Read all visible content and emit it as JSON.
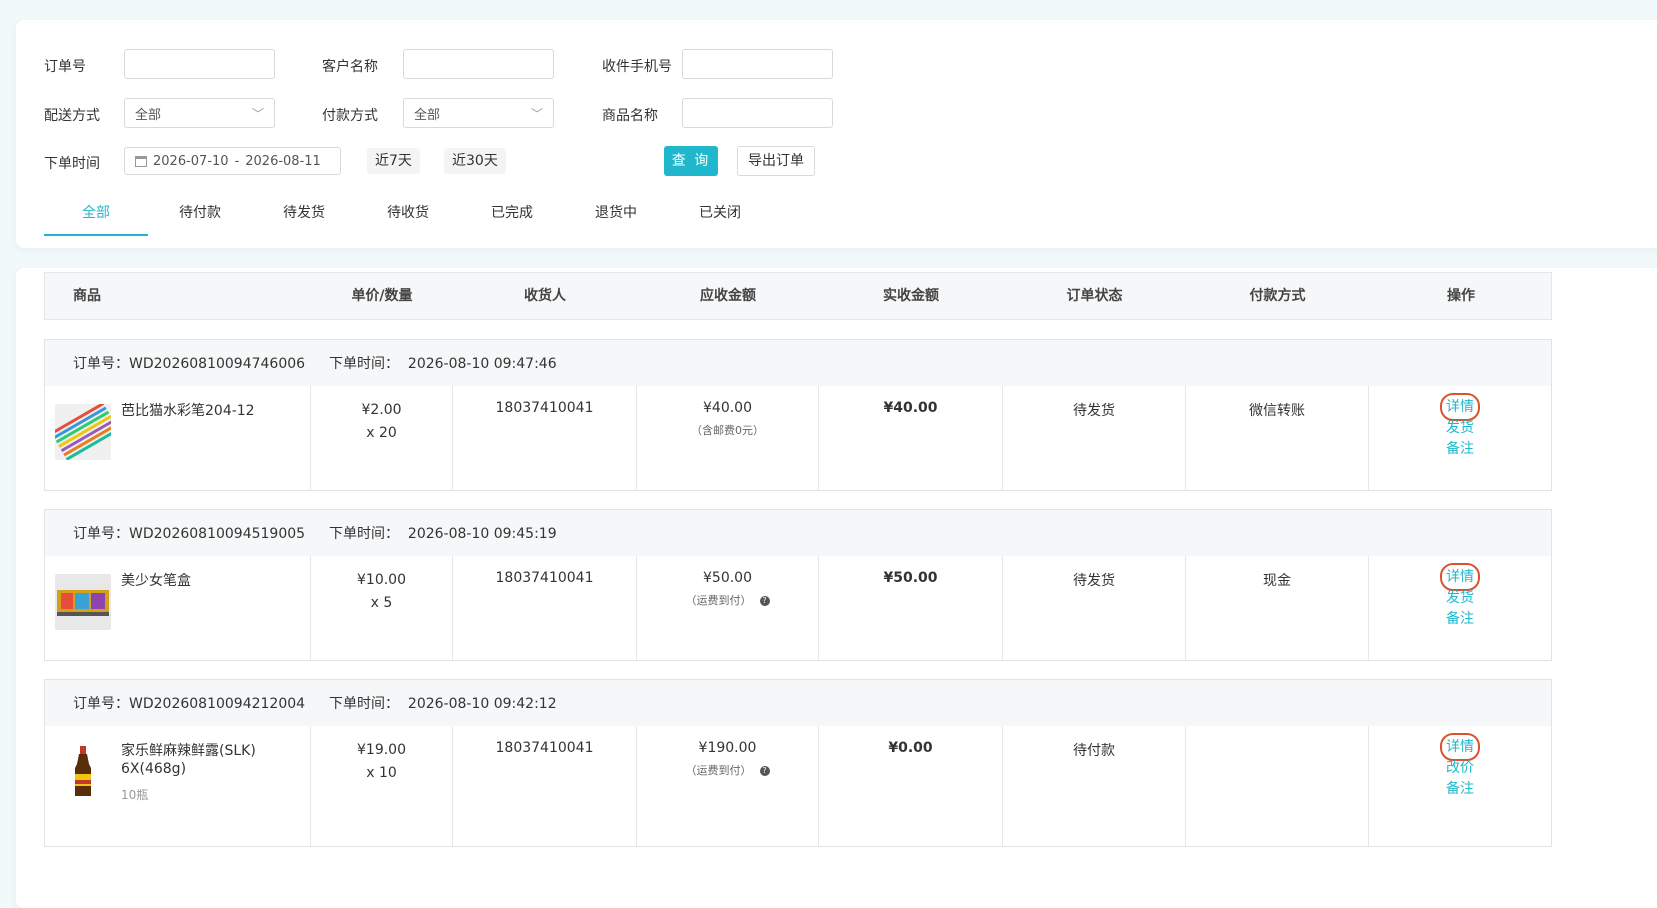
{
  "filters": {
    "order_no_label": "订单号",
    "customer_label": "客户名称",
    "phone_label": "收件手机号",
    "delivery_label": "配送方式",
    "delivery_value": "全部",
    "payment_label": "付款方式",
    "payment_value": "全部",
    "product_label": "商品名称",
    "order_time_label": "下单时间",
    "date_start": "2026-07-10",
    "date_sep": "-",
    "date_end": "2026-08-11",
    "quick_7": "近7天",
    "quick_30": "近30天",
    "query_button": "查 询",
    "export_button": "导出订单"
  },
  "tabs": [
    "全部",
    "待付款",
    "待发货",
    "待收货",
    "已完成",
    "退货中",
    "已关闭"
  ],
  "table_headers": [
    "商品",
    "单价/数量",
    "收货人",
    "应收金额",
    "实收金额",
    "订单状态",
    "付款方式",
    "操作"
  ],
  "order_no_prefix": "订单号：",
  "order_time_prefix": "下单时间：",
  "orders": [
    {
      "order_no": "WD20260810094746006",
      "order_time": "2026-08-10 09:47:46",
      "product": "芭比猫水彩笔204-12",
      "sub": "",
      "unit_price": "¥2.00",
      "qty": "x 20",
      "receiver": "18037410041",
      "receivable": "¥40.00",
      "receivable_note": "（含邮费0元）",
      "received": "¥40.00",
      "status": "待发货",
      "payment": "微信转账",
      "actions": [
        "详情",
        "发货",
        "备注"
      ]
    },
    {
      "order_no": "WD20260810094519005",
      "order_time": "2026-08-10 09:45:19",
      "product": "美少女笔盒",
      "sub": "",
      "unit_price": "¥10.00",
      "qty": "x 5",
      "receiver": "18037410041",
      "receivable": "¥50.00",
      "receivable_note": "（运费到付）",
      "received": "¥50.00",
      "status": "待发货",
      "payment": "现金",
      "actions": [
        "详情",
        "发货",
        "备注"
      ]
    },
    {
      "order_no": "WD20260810094212004",
      "order_time": "2026-08-10 09:42:12",
      "product": "家乐鲜麻辣鲜露(SLK) 6X(468g)",
      "sub": "10瓶",
      "unit_price": "¥19.00",
      "qty": "x 10",
      "receiver": "18037410041",
      "receivable": "¥190.00",
      "receivable_note": "（运费到付）",
      "received": "¥0.00",
      "status": "待付款",
      "payment": "",
      "actions": [
        "详情",
        "改价",
        "备注"
      ]
    }
  ],
  "colors": {
    "accent": "#20b7cc",
    "highlight": "#d9532c"
  }
}
